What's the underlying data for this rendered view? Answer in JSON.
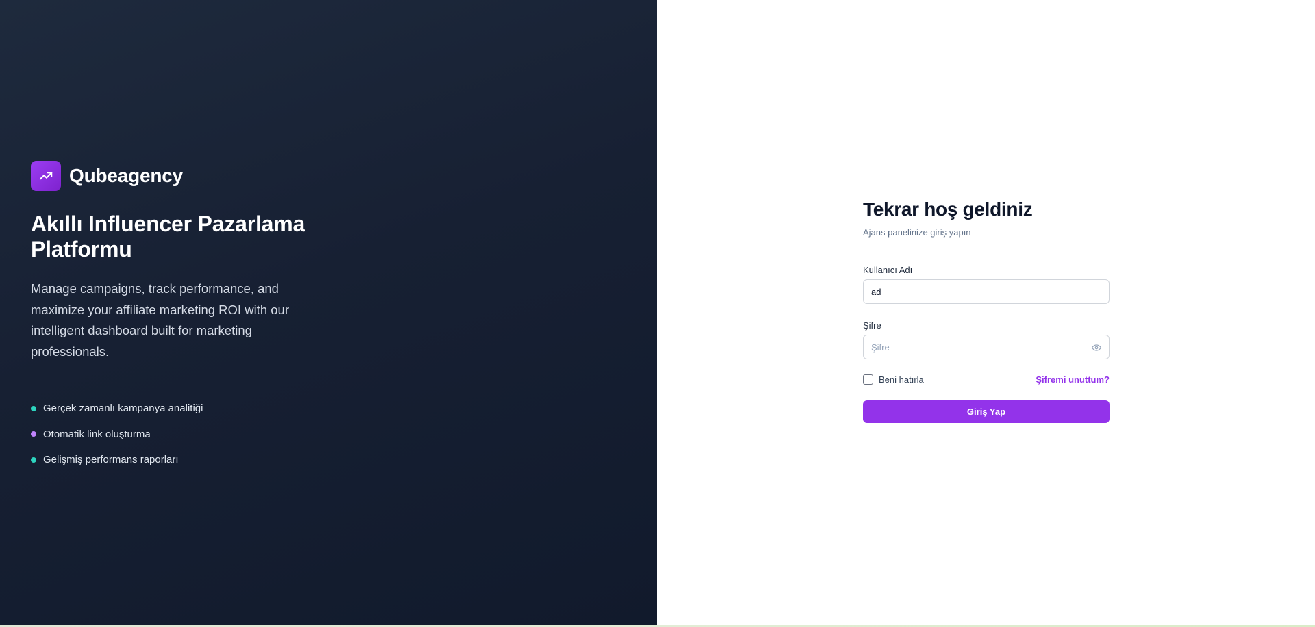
{
  "hero": {
    "brand_name": "Qubeagency",
    "brand_icon": "trending-up-icon",
    "title": "Akıllı Influencer Pazarlama Platformu",
    "description": "Manage campaigns, track performance, and maximize your affiliate marketing ROI with our intelligent dashboard built for marketing professionals.",
    "features": [
      {
        "label": "Gerçek zamanlı kampanya analitiği",
        "dot_color": "#2dd4bf"
      },
      {
        "label": "Otomatik link oluşturma",
        "dot_color": "#c084fc"
      },
      {
        "label": "Gelişmiş performans raporları",
        "dot_color": "#2dd4bf"
      }
    ]
  },
  "login": {
    "title": "Tekrar hoş geldiniz",
    "subtitle": "Ajans panelinize giriş yapın",
    "username": {
      "label": "Kullanıcı Adı",
      "value": "ad"
    },
    "password": {
      "label": "Şifre",
      "placeholder": "Şifre",
      "value": "",
      "toggle_icon": "eye-icon"
    },
    "remember_label": "Beni hatırla",
    "remember_checked": false,
    "forgot_label": "Şifremi unuttum?",
    "submit_label": "Giriş Yap"
  },
  "colors": {
    "accent": "#9333ea",
    "hero_bg": "#172033",
    "teal": "#2dd4bf",
    "lavender": "#c084fc"
  }
}
